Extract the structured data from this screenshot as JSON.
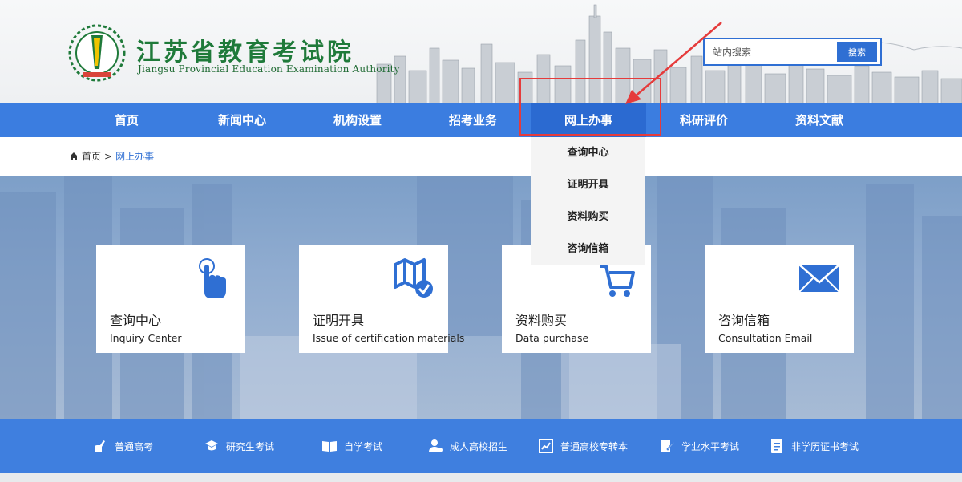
{
  "header": {
    "title_cn": "江苏省教育考试院",
    "title_en": "Jiangsu Provincial Education Examination Authority"
  },
  "search": {
    "placeholder": "站内搜索",
    "button_label": "搜索"
  },
  "nav": {
    "items": [
      {
        "label": "首页"
      },
      {
        "label": "新闻中心"
      },
      {
        "label": "机构设置"
      },
      {
        "label": "招考业务"
      },
      {
        "label": "网上办事"
      },
      {
        "label": "科研评价"
      },
      {
        "label": "资料文献"
      }
    ],
    "active_index": 4
  },
  "breadcrumb": {
    "home": "首页",
    "separator": ">",
    "current": "网上办事"
  },
  "dropdown": {
    "items": [
      "查询中心",
      "证明开具",
      "资料购买",
      "咨询信箱"
    ]
  },
  "cards": [
    {
      "title": "查询中心",
      "subtitle": "Inquiry Center",
      "icon": "touch-hand-icon"
    },
    {
      "title": "证明开具",
      "subtitle": "Issue of certification materials",
      "icon": "map-check-icon"
    },
    {
      "title": "资料购买",
      "subtitle": "Data purchase",
      "icon": "shopping-cart-icon"
    },
    {
      "title": "咨询信箱",
      "subtitle": "Consultation Email",
      "icon": "envelope-icon"
    }
  ],
  "bottom_links": [
    {
      "label": "普通高考",
      "icon": "writing-hand-icon"
    },
    {
      "label": "研究生考试",
      "icon": "graduation-cap-icon"
    },
    {
      "label": "自学考试",
      "icon": "open-book-icon"
    },
    {
      "label": "成人高校招生",
      "icon": "adult-person-icon"
    },
    {
      "label": "普通高校专转本",
      "icon": "chart-document-icon"
    },
    {
      "label": "学业水平考试",
      "icon": "pen-paper-icon"
    },
    {
      "label": "非学历证书考试",
      "icon": "certificate-icon"
    }
  ],
  "colors": {
    "nav_blue": "#3b7de0",
    "logo_green": "#1f7a3a",
    "annotation_red": "#e53b3b",
    "icon_blue": "#2f6fd3"
  }
}
